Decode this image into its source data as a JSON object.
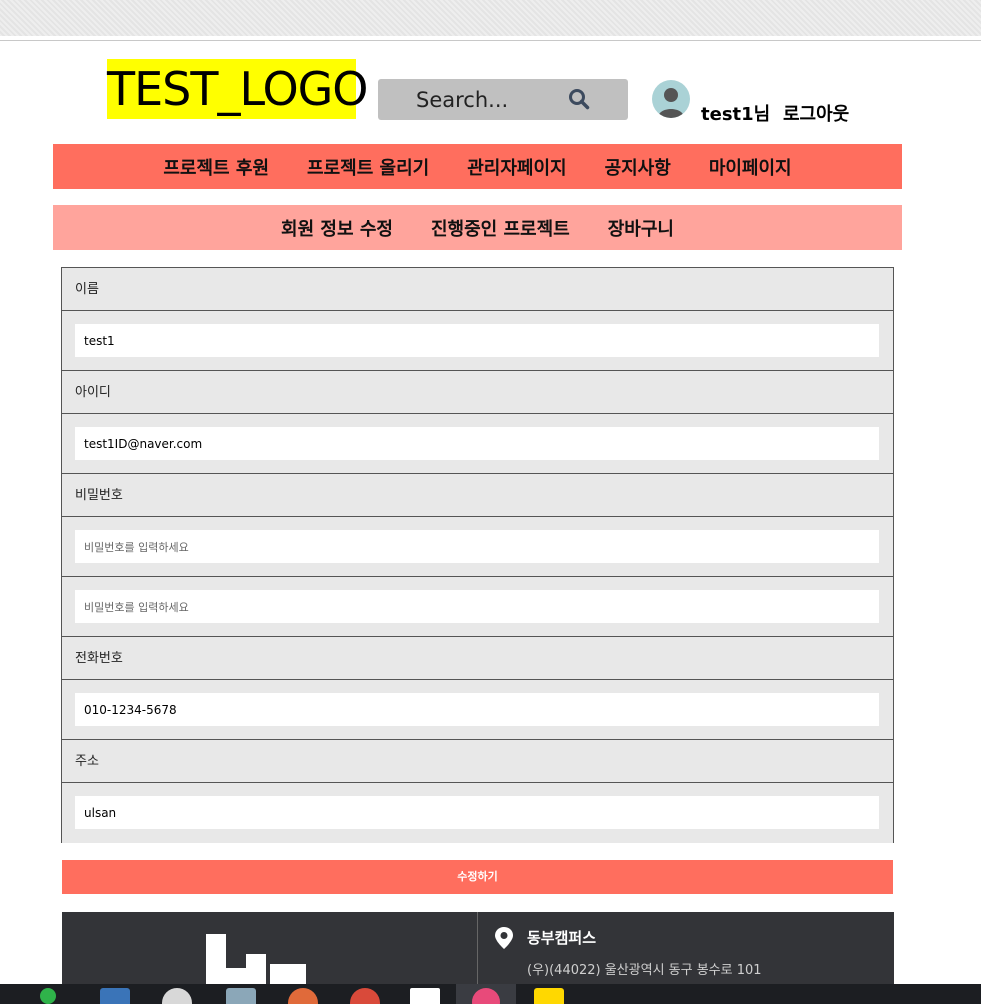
{
  "header": {
    "logo": "TEST_LOGO",
    "search_placeholder": "Search...",
    "user_name": "test1님",
    "logout_label": "로그아웃"
  },
  "main_nav": [
    "프로젝트 후원",
    "프로젝트 올리기",
    "관리자페이지",
    "공지사항",
    "마이페이지"
  ],
  "sub_nav": [
    "회원 정보 수정",
    "진행중인 프로젝트",
    "장바구니"
  ],
  "form": {
    "name_label": "이름",
    "name_value": "test1",
    "id_label": "아이디",
    "id_value": "test1ID@naver.com",
    "password_label": "비밀번호",
    "password_placeholder": "비밀번호를 입력하세요",
    "password_confirm_placeholder": "비밀번호를 입력하세요",
    "phone_label": "전화번호",
    "phone_value": "010-1234-5678",
    "address_label": "주소",
    "address_value": "ulsan",
    "submit_label": "수정하기"
  },
  "footer": {
    "campus_name": "동부캠퍼스",
    "address": "(우)(44022) 울산광역시 동구 봉수로 101"
  },
  "colors": {
    "accent": "#ff6e5e",
    "accent_light": "#ffa49c",
    "logo_bg": "#ffff00",
    "footer_bg": "#333438"
  }
}
